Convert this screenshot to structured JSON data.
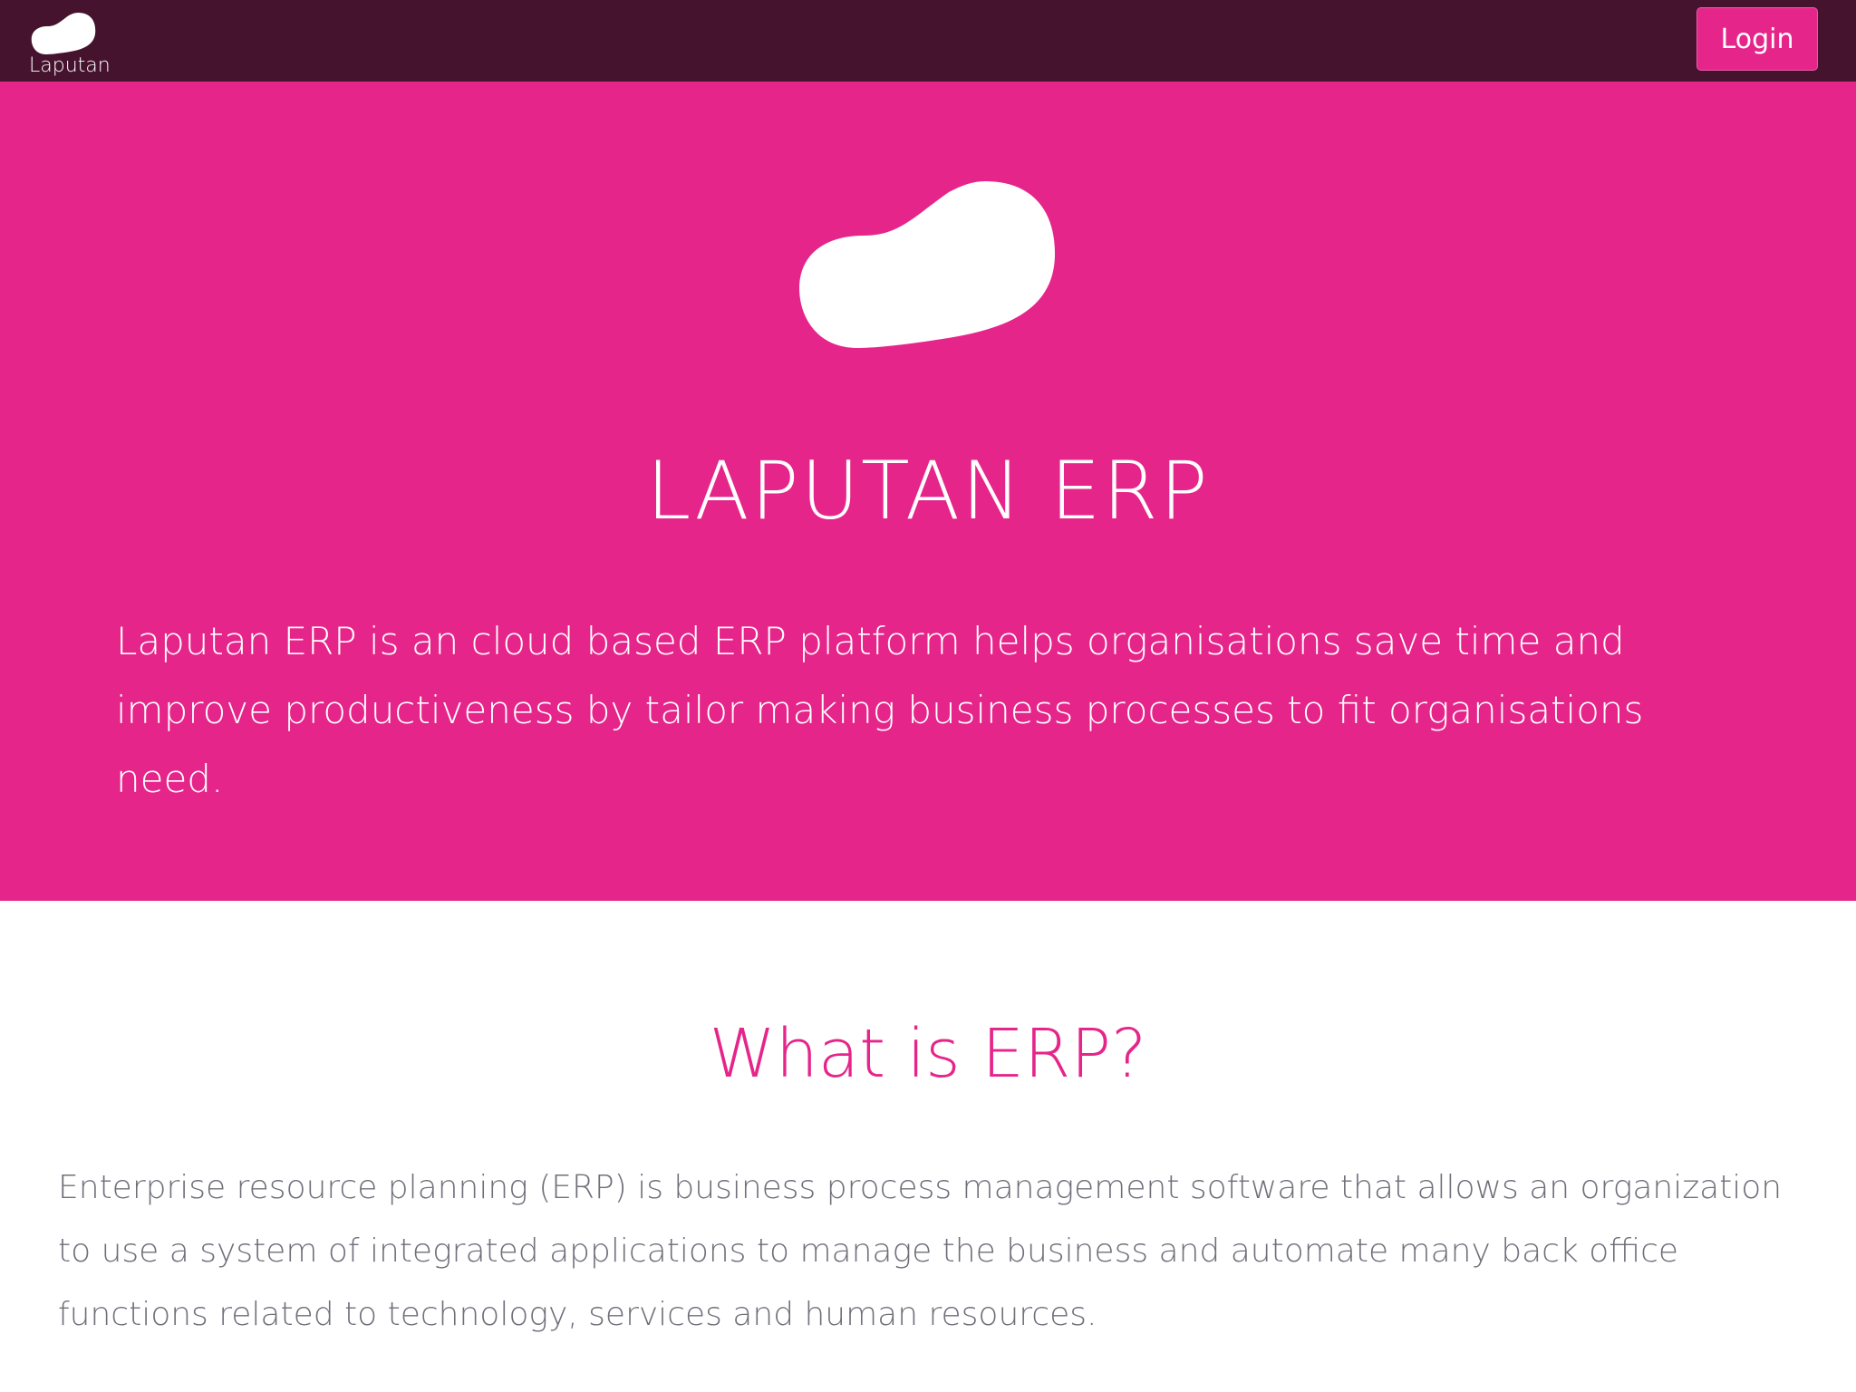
{
  "header": {
    "brand_name": "Laputan",
    "login_label": "Login"
  },
  "hero": {
    "title": "LAPUTAN ERP",
    "description": "Laputan ERP is an cloud based ERP platform helps organisations save time and improve productiveness by tailor making business processes to fit organisations need."
  },
  "about": {
    "heading": "What is ERP?",
    "description": "Enterprise resource planning (ERP) is business process management software that allows an organization to use a system of integrated applications to manage the business and automate many back office functions related to technology, services and human resources."
  },
  "colors": {
    "topbar": "#46132f",
    "accent": "#e5258a",
    "body_text": "#6f6f7a",
    "white": "#ffffff"
  },
  "icons": {
    "brand": "cloud-blob-icon",
    "hero": "cloud-blob-icon"
  }
}
